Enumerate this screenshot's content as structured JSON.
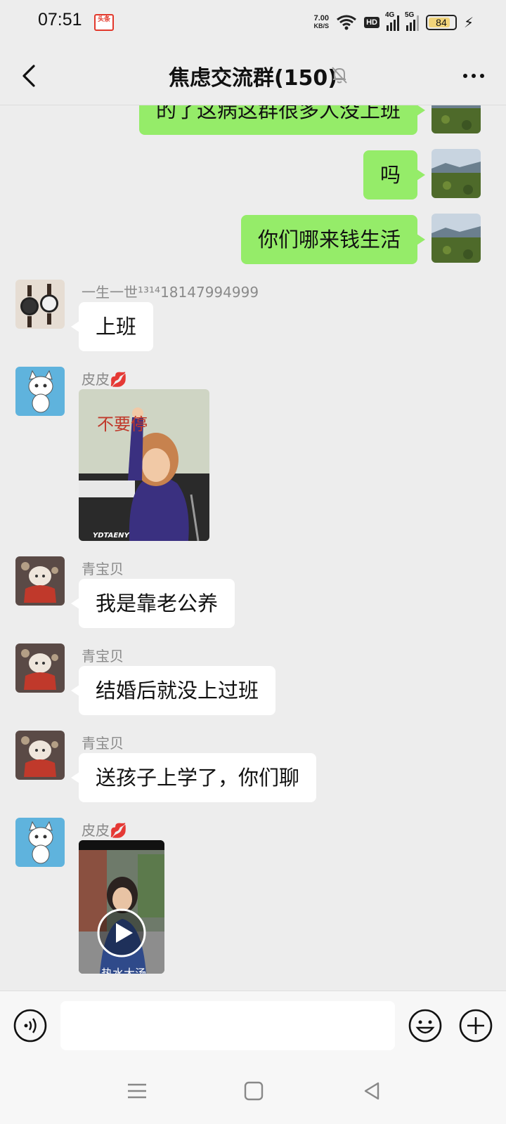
{
  "status_bar": {
    "time": "07:51",
    "app_badge": "头条",
    "net_speed_value": "7.00",
    "net_speed_unit": "KB/S",
    "hd": "HD",
    "sim1": "4G",
    "sim2": "5G",
    "battery": "84",
    "battery_level": 0.84
  },
  "header": {
    "title": "焦虑交流群(150)"
  },
  "messages": [
    {
      "side": "out",
      "text": "的了这病这群很多人没上班"
    },
    {
      "side": "out",
      "text": "吗"
    },
    {
      "side": "out",
      "text": "你们哪来钱生活"
    },
    {
      "side": "in",
      "sender": "一生一世¹³¹⁴18147994999",
      "text": "上班"
    },
    {
      "side": "in",
      "sender": "皮皮💋",
      "image_caption": "不要停",
      "watermark": "YDTAENY"
    },
    {
      "side": "in",
      "sender": "青宝贝",
      "text": "我是靠老公养"
    },
    {
      "side": "in",
      "sender": "青宝贝",
      "text": "结婚后就没上过班"
    },
    {
      "side": "in",
      "sender": "青宝贝",
      "text": "送孩子上学了，你们聊"
    },
    {
      "side": "in",
      "sender": "皮皮💋",
      "video_caption": "热水大汤"
    }
  ],
  "input": {
    "value": "",
    "placeholder": ""
  },
  "colors": {
    "background": "#ededed",
    "outgoing_bubble": "#95ec69",
    "incoming_bubble": "#ffffff",
    "sender_name": "#8a8a8a"
  },
  "icons": [
    "back-arrow-icon",
    "mute-bell-icon",
    "more-icon",
    "voice-icon",
    "emoji-icon",
    "plus-icon",
    "menu-icon",
    "home-icon",
    "back-triangle-icon"
  ]
}
